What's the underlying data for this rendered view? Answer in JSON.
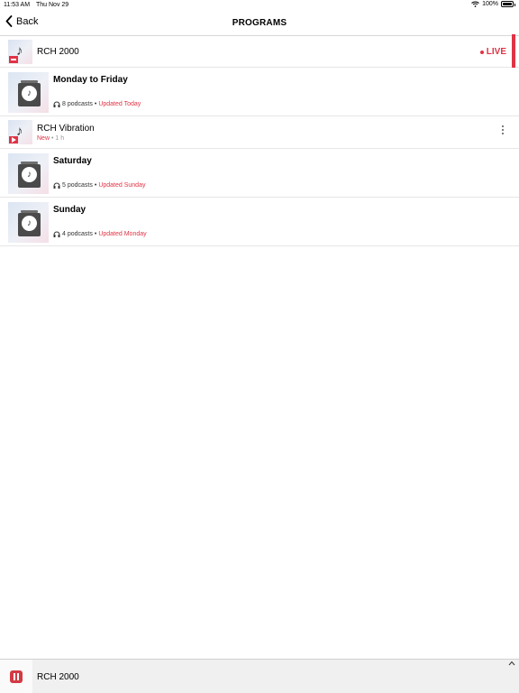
{
  "status_bar": {
    "time": "11:53 AM",
    "date": "Thu Nov 29",
    "battery": "100%"
  },
  "nav": {
    "back_label": "Back",
    "title": "PROGRAMS"
  },
  "live_item": {
    "title": "RCH 2000",
    "live_label": "LIVE"
  },
  "programs": [
    {
      "title": "Monday to Friday",
      "podcasts": "8 podcasts",
      "separator": "•",
      "updated": "Updated Today"
    },
    {
      "title": "Saturday",
      "podcasts": "5 podcasts",
      "separator": "•",
      "updated": "Updated Sunday"
    },
    {
      "title": "Sunday",
      "podcasts": "4 podcasts",
      "separator": "•",
      "updated": "Updated Monday"
    }
  ],
  "episode": {
    "title": "RCH Vibration",
    "new_label": "New",
    "separator": "•",
    "duration": "1 h"
  },
  "mini_player": {
    "title": "RCH 2000"
  },
  "colors": {
    "accent": "#e03345",
    "divider": "#e6e6e6",
    "player_bg": "#f0f0f0"
  },
  "icons": {
    "back": "chevron-left-icon",
    "wifi": "wifi-icon",
    "battery": "battery-icon",
    "music_note": "music-note-icon",
    "folder": "podcast-folder-icon",
    "headphones": "headphones-icon",
    "more": "more-vertical-icon",
    "pause": "pause-icon",
    "expand": "chevron-up-icon"
  }
}
